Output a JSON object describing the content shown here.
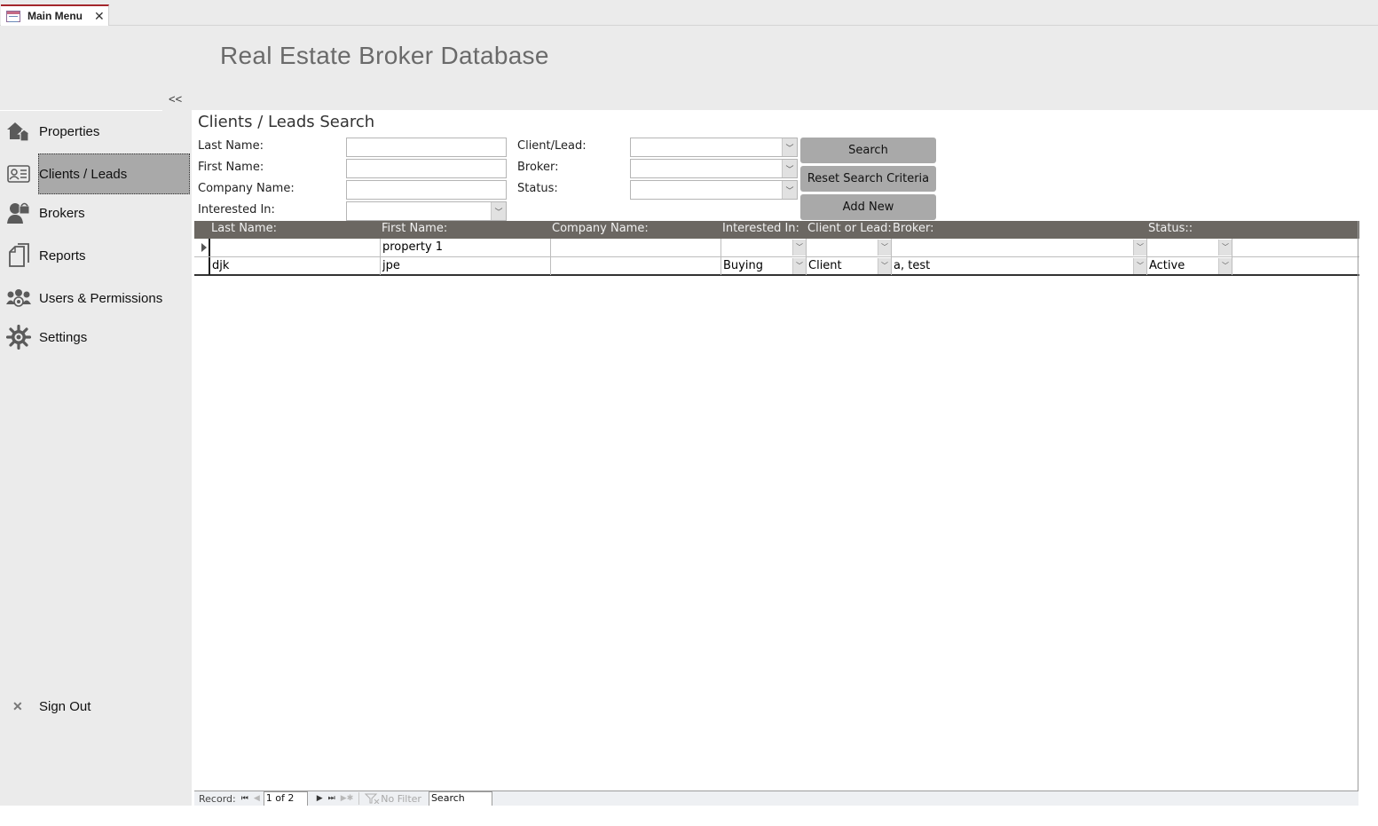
{
  "tab": {
    "label": "Main Menu",
    "close_icon": "close-icon"
  },
  "header": {
    "title": "Real Estate Broker Database",
    "collapse_label": "<<"
  },
  "sidebar": {
    "items": [
      {
        "label": "Properties",
        "icon": "house-icon",
        "active": false
      },
      {
        "label": "Clients / Leads",
        "icon": "contact-card-icon",
        "active": true
      },
      {
        "label": "Brokers",
        "icon": "broker-icon",
        "active": false
      },
      {
        "label": "Reports",
        "icon": "reports-icon",
        "active": false
      },
      {
        "label": "Users & Permissions",
        "icon": "users-icon",
        "active": false
      },
      {
        "label": "Settings",
        "icon": "gear-icon",
        "active": false
      }
    ],
    "signout": {
      "label": "Sign Out",
      "icon": "close-icon"
    }
  },
  "form": {
    "title": "Clients / Leads Search",
    "fields": {
      "last_name": {
        "label": "Last Name:",
        "value": ""
      },
      "first_name": {
        "label": "First Name:",
        "value": ""
      },
      "company_name": {
        "label": "Company Name:",
        "value": ""
      },
      "interested_in": {
        "label": "Interested In:",
        "value": ""
      },
      "client_lead": {
        "label": "Client/Lead:",
        "value": ""
      },
      "broker": {
        "label": "Broker:",
        "value": ""
      },
      "status": {
        "label": "Status:",
        "value": ""
      }
    },
    "buttons": {
      "search": "Search",
      "reset": "Reset Search Criteria",
      "add_new": "Add New"
    }
  },
  "grid": {
    "columns": [
      "Last Name:",
      "First Name:",
      "Company Name:",
      "Interested In:",
      "Client or Lead:",
      "Broker:",
      "Status::"
    ],
    "rows": [
      {
        "last_name": "",
        "first_name": "property 1",
        "company_name": "",
        "interested_in": "",
        "client_lead": "",
        "broker": "",
        "status": "",
        "current": true
      },
      {
        "last_name": "djk",
        "first_name": "jpe",
        "company_name": "",
        "interested_in": "Buying",
        "client_lead": "Client",
        "broker": "a, test",
        "status": "Active",
        "current": false
      }
    ]
  },
  "record_nav": {
    "label": "Record:",
    "position": "1 of 2",
    "filter_label": "No Filter",
    "search_label": "Search"
  }
}
